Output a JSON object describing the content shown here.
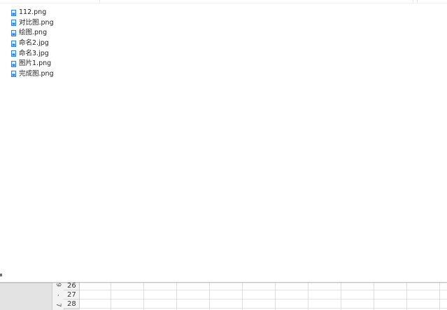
{
  "files": [
    {
      "name": "112.png"
    },
    {
      "name": "对比图.png"
    },
    {
      "name": "绘图.png"
    },
    {
      "name": "命名2.jpg"
    },
    {
      "name": "命名3.jpg"
    },
    {
      "name": "图片1.png"
    },
    {
      "name": "完成图.png"
    }
  ],
  "sheet": {
    "rows": [
      "26",
      "27",
      "28"
    ],
    "ruler_marks": [
      "9",
      "-",
      "7"
    ]
  },
  "colors": {
    "icon_blue": "#2f7fd6",
    "icon_page": "#e8eef7"
  }
}
